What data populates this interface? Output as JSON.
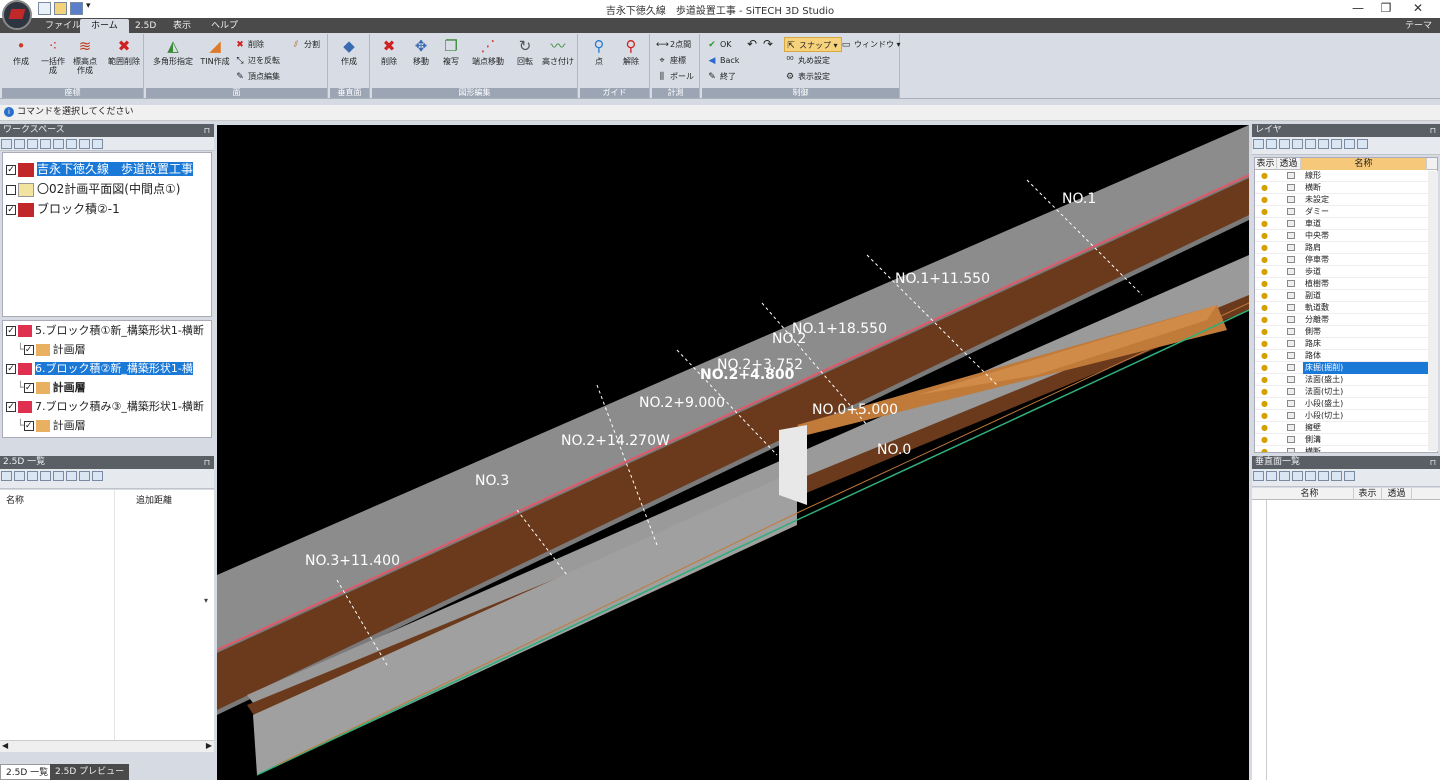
{
  "window": {
    "title": "吉永下徳久線　歩道設置工事 - SiTECH 3D Studio",
    "controls": [
      "—",
      "❐",
      "✕"
    ]
  },
  "tabs": {
    "file": "ファイル",
    "home": "ホーム",
    "v25d": "2.5D",
    "view": "表示",
    "help": "ヘルプ",
    "theme": "テーマ"
  },
  "ribbon": {
    "groups": {
      "coord": "座標",
      "face": "面",
      "vface": "垂直面",
      "edit": "図形編集",
      "guide": "ガイド",
      "measure": "計測",
      "control": "制御"
    },
    "buttons": {
      "create": "作成",
      "batch_create": "一括作成",
      "elev_create": "標高点作成",
      "range_delete": "範囲削除",
      "polygon": "多角形指定",
      "tin": "TIN作成",
      "face_delete": "削除",
      "edge_flip": "辺を反転",
      "vertex_edit": "頂点編集",
      "split": "分割",
      "vcreate": "作成",
      "delete": "削除",
      "move": "移動",
      "copy": "複写",
      "endpoint_move": "端点移動",
      "rotate": "回転",
      "set_height": "高さ付け",
      "point": "点",
      "release": "解除",
      "two_point": "2点間",
      "coord": "座標",
      "pole": "ポール",
      "ok": "OK",
      "back": "Back",
      "end": "終了",
      "snap": "スナップ",
      "window": "ウィンドウ",
      "round_setting": "丸め設定",
      "display_setting": "表示設定"
    }
  },
  "command_bar": {
    "text": "コマンドを選択してください"
  },
  "workspace": {
    "title": "ワークスペース",
    "items": [
      {
        "label": "吉永下徳久線　歩道設置工事",
        "checked": true,
        "selected": true
      },
      {
        "label": "〇02計画平面図(中間点①)",
        "checked": false,
        "selected": false
      },
      {
        "label": "ブロック積②-1",
        "checked": true,
        "selected": false
      }
    ]
  },
  "tree_list": {
    "items": [
      {
        "label": "5.ブロック積①新_構築形状1-横断",
        "indent": 0,
        "selected": false
      },
      {
        "label": "計画層",
        "indent": 1,
        "selected": false
      },
      {
        "label": "6.ブロック積②新_構築形状1-横",
        "indent": 0,
        "selected": true
      },
      {
        "label": "計画層",
        "indent": 1,
        "selected": false,
        "bold": true
      },
      {
        "label": "7.ブロック積み③_構築形状1-横断",
        "indent": 0,
        "selected": false
      },
      {
        "label": "計画層",
        "indent": 1,
        "selected": false
      }
    ]
  },
  "list25d": {
    "title": "2.5D 一覧",
    "col_name": "名称",
    "col_dist": "追加距離"
  },
  "bottom_tabs": {
    "list": "2.5D 一覧",
    "preview": "2.5D プレビュー"
  },
  "layers": {
    "title": "レイヤ",
    "col_show": "表示",
    "col_trans": "透過",
    "col_name": "名称",
    "items": [
      "線形",
      "横断",
      "未設定",
      "ダミー",
      "車道",
      "中央帯",
      "路肩",
      "停車帯",
      "歩道",
      "植樹帯",
      "副道",
      "軌道敷",
      "分離帯",
      "側帯",
      "路床",
      "路体",
      "床掘(掘削)",
      "法面(盛土)",
      "法面(切土)",
      "小段(盛土)",
      "小段(切土)",
      "擁壁",
      "側溝",
      "横断"
    ],
    "highlighted": "床掘(掘削)"
  },
  "vsurf": {
    "title": "垂直面一覧",
    "col_name": "名称",
    "col_show": "表示",
    "col_trans": "透過"
  },
  "viewport": {
    "stations": [
      "NO.1",
      "NO.1+11.550",
      "NO.1+18.550",
      "NO.2",
      "NO.2+3.752",
      "NO.2+4.800",
      "NO.2+9.000",
      "NO.0+5.000",
      "NO.0",
      "NO.2+14.270W",
      "NO.3",
      "NO.3+11.400"
    ]
  },
  "colors": {
    "selection": "#1a78d7",
    "road": "#8a8a8a",
    "sidewalk": "#6b3a1c",
    "excavation": "#c07a3a",
    "curb_line": "#e05a6a",
    "ground_line": "#2fae7a"
  }
}
